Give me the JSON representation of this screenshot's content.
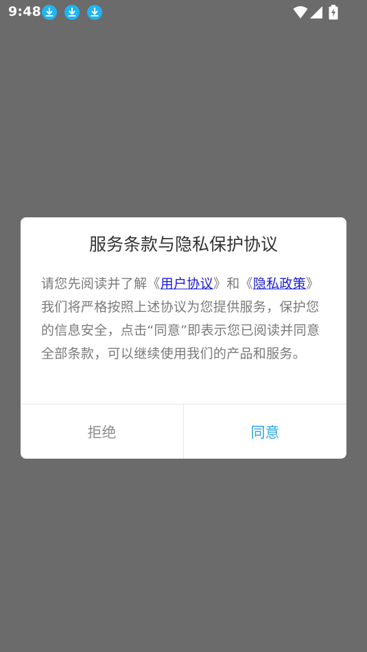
{
  "status_bar": {
    "time": "9:48",
    "notification_icons": [
      "download-icon",
      "download-icon",
      "download-icon"
    ],
    "system_icons": [
      "wifi-icon",
      "signal-icon",
      "battery-charging-icon"
    ]
  },
  "dialog": {
    "title": "服务条款与隐私保护协议",
    "body_prefix": "请您先阅读并了解《",
    "user_agreement_link": "用户协议",
    "body_middle": "》和《",
    "privacy_policy_link": "隐私政策",
    "body_suffix": "》我们将严格按照上述协议为您提供服务，保护您的信息安全，点击“同意”即表示您已阅读并同意全部条款，可以继续使用我们的产品和服务。",
    "reject_label": "拒绝",
    "agree_label": "同意"
  },
  "colors": {
    "overlay": "#6b6b6b",
    "dialog_bg": "#ffffff",
    "title": "#333333",
    "body_text": "#7a7a7a",
    "link": "#1a1ad6",
    "reject_text": "#8c8c8c",
    "agree_text": "#2ba5e6",
    "download_badge": "#1fb4f4"
  }
}
